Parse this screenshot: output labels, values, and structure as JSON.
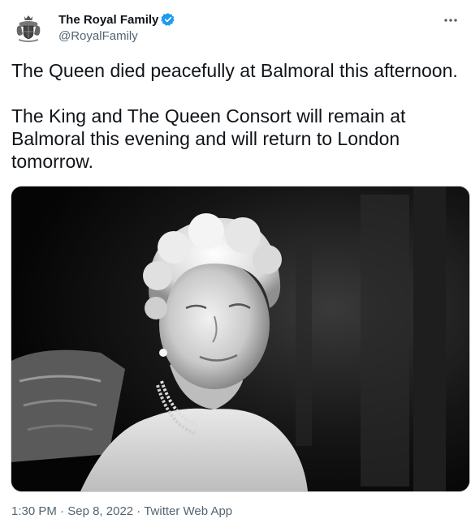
{
  "author": {
    "display_name": "The Royal Family",
    "handle": "@RoyalFamily",
    "avatar_icon": "royal-coat-of-arms-icon",
    "verified": true,
    "verified_color": "#1d9bf0"
  },
  "tweet": {
    "text": "The Queen died peacefully at Balmoral this afternoon.\n\nThe King and The Queen Consort will remain at Balmoral this evening and will return to London tomorrow.",
    "image_icon": "portrait-photo"
  },
  "meta": {
    "time": "1:30 PM",
    "separator": " · ",
    "date": "Sep 8, 2022",
    "source": "Twitter Web App"
  },
  "menu": {
    "icon": "more-icon"
  }
}
